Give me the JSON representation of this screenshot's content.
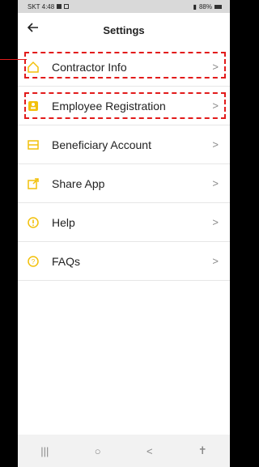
{
  "status": {
    "carrier_time": "SKT 4:48",
    "right": "88%"
  },
  "header": {
    "title": "Settings",
    "back_icon": "arrow-left-icon"
  },
  "menu": [
    {
      "label": "Contractor Info",
      "icon": "home-icon"
    },
    {
      "label": "Employee Registration",
      "icon": "badge-icon"
    },
    {
      "label": "Beneficiary Account",
      "icon": "bank-icon"
    },
    {
      "label": "Share App",
      "icon": "share-icon"
    },
    {
      "label": "Help",
      "icon": "alert-circle-icon"
    },
    {
      "label": "FAQs",
      "icon": "question-circle-icon"
    }
  ],
  "colors": {
    "accent": "#f2c00a",
    "highlight": "#e21b1b"
  }
}
